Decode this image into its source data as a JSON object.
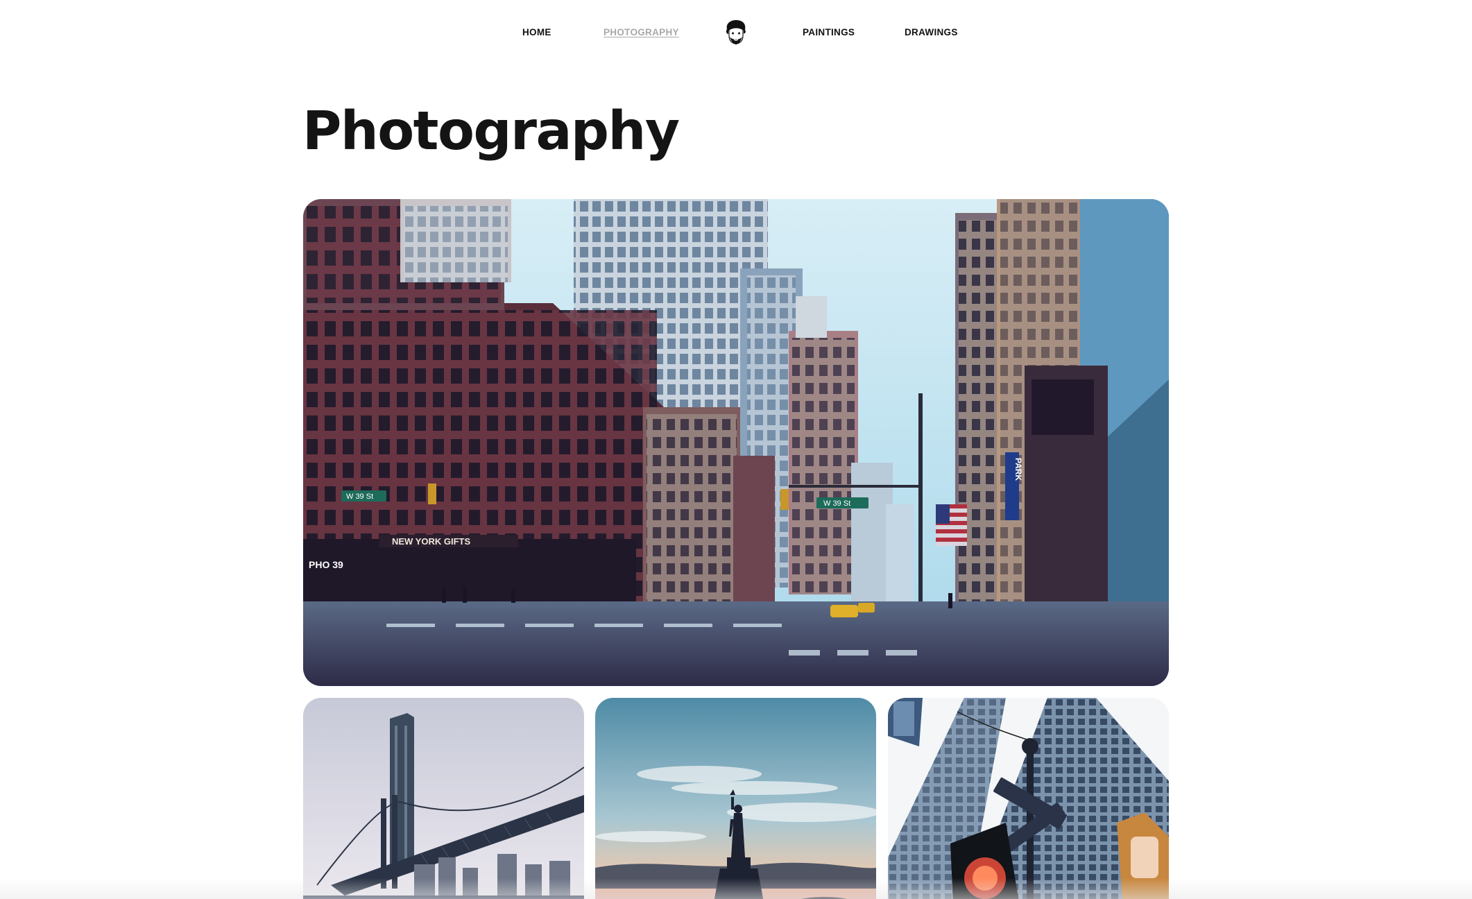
{
  "nav": {
    "home_label": "HOME",
    "photography_label": "PHOTOGRAPHY",
    "paintings_label": "PAINTINGS",
    "drawings_label": "DRAWINGS",
    "logo_icon": "face-avatar-icon",
    "active_item": "PHOTOGRAPHY"
  },
  "page": {
    "title": "Photography"
  },
  "gallery": {
    "hero": {
      "signs": {
        "street_left": "W 39 St",
        "street_right": "W 39 St",
        "store": "NEW YORK GIFTS",
        "shop": "PHO 39",
        "park": "PARK"
      }
    },
    "thumbnails": [
      {
        "subject": "bridge"
      },
      {
        "subject": "statue"
      },
      {
        "subject": "skyscraper-street-sign"
      }
    ]
  },
  "colors": {
    "text": "#141414",
    "nav_active": "#a9a9a9",
    "background": "#ffffff"
  }
}
